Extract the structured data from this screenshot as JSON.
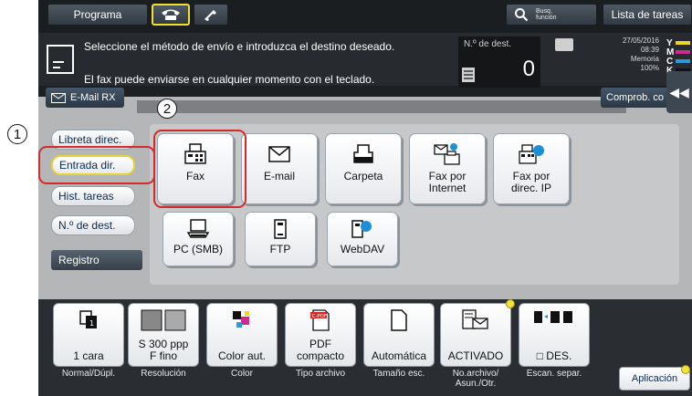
{
  "topbar": {
    "programa": "Programa",
    "busq_line1": "Busq.",
    "busq_line2": "función",
    "lista": "Lista de tareas"
  },
  "message": {
    "line1": "Seleccione el método de envío e introduzca el destino deseado.",
    "line2": "El fax puede enviarse en cualquier momento con el teclado."
  },
  "dest": {
    "label": "N.º de dest.",
    "value": "0"
  },
  "status": {
    "date": "27/05/2016",
    "time": "08:39",
    "memory_label": "Memoria",
    "memory_value": "100%"
  },
  "toner": [
    {
      "letter": "Y",
      "color": "#f0d42a"
    },
    {
      "letter": "M",
      "color": "#d12a8e"
    },
    {
      "letter": "C",
      "color": "#2a9ad8"
    },
    {
      "letter": "K",
      "color": "#111111"
    }
  ],
  "emailrx": "E-Mail RX",
  "comprob": "Comprob. co",
  "sidebar": {
    "items": [
      "Libreta direc.",
      "Entrada dir.",
      "Hist. tareas",
      "N.º de dest."
    ],
    "registro": "Registro"
  },
  "tiles": [
    {
      "label": "Fax",
      "icon": "fax-icon"
    },
    {
      "label": "E-mail",
      "icon": "email-icon"
    },
    {
      "label": "Carpeta",
      "icon": "folder-icon"
    },
    {
      "label": "Fax por\nInternet",
      "icon": "internet-fax-icon"
    },
    {
      "label": "Fax por\ndirec. IP",
      "icon": "ip-fax-icon"
    },
    {
      "label": "PC (SMB)",
      "icon": "pc-icon"
    },
    {
      "label": "FTP",
      "icon": "ftp-icon"
    },
    {
      "label": "WebDAV",
      "icon": "webdav-icon"
    }
  ],
  "bottom": [
    {
      "value": "1 cara",
      "caption": "Normal/Dúpl."
    },
    {
      "value": "S 300 ppp\nF fino",
      "caption": "Resolución"
    },
    {
      "value": "Color aut.",
      "caption": "Color"
    },
    {
      "value": "PDF\ncompacto",
      "caption": "Tipo archivo",
      "badge": "C-PDF"
    },
    {
      "value": "Automática",
      "caption": "Tamaño esc."
    },
    {
      "value": "ACTIVADO",
      "caption": "No.archivo/\nAsun./Otr."
    },
    {
      "value": "DES.",
      "caption": "Escan. separ."
    }
  ],
  "aplicacion": "Aplicación",
  "callouts": [
    "1",
    "2"
  ]
}
